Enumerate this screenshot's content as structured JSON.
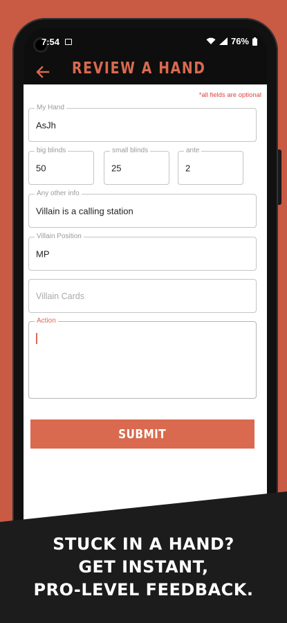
{
  "status_bar": {
    "time": "7:54",
    "battery": "76%"
  },
  "app_bar": {
    "title": "REVIEW A HAND",
    "back_icon": "arrow-left-icon"
  },
  "form": {
    "optional_note": "*all fields are optional",
    "my_hand": {
      "label": "My Hand",
      "value": "AsJh"
    },
    "big_blinds": {
      "label": "big blinds",
      "value": "50"
    },
    "small_blinds": {
      "label": "small blinds",
      "value": "25"
    },
    "ante": {
      "label": "ante",
      "value": "2"
    },
    "other_info": {
      "label": "Any other info",
      "value": "Villain is a calling station"
    },
    "villain_position": {
      "label": "Villain Position",
      "value": "MP"
    },
    "villain_cards": {
      "placeholder": "Villain Cards"
    },
    "action": {
      "label": "Action",
      "value": ""
    },
    "submit_label": "SUBMIT"
  },
  "banner": {
    "line1": "STUCK IN A HAND?",
    "line2": "GET INSTANT,",
    "line3": "PRO-LEVEL FEEDBACK."
  },
  "colors": {
    "background": "#c95a44",
    "accent": "#d96a4f",
    "required_note": "#e04040",
    "banner": "#1c1c1c"
  }
}
